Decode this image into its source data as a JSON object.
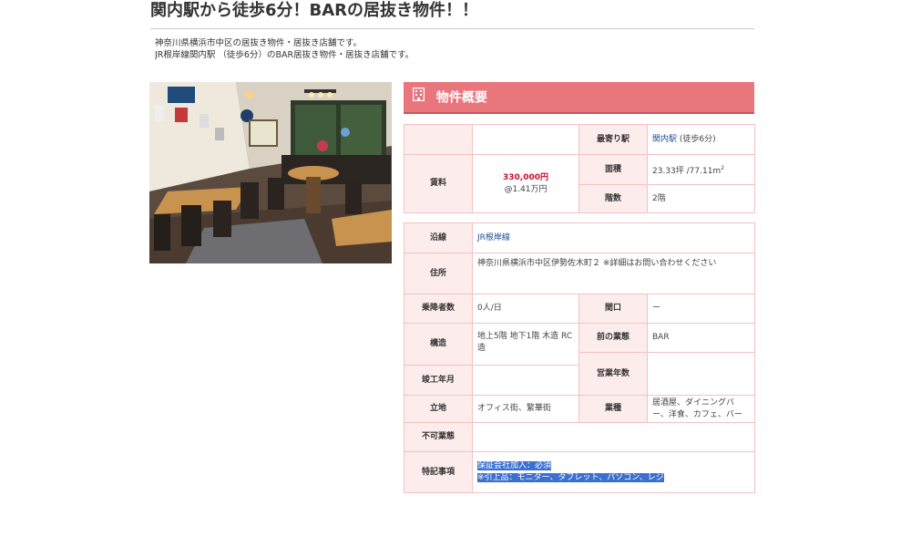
{
  "page": {
    "title": "関内駅から徒歩6分！BARの居抜き物件！！",
    "description_lines": [
      "神奈川県横浜市中区の居抜き物件・居抜き店舗です。",
      "JR根岸線関内駅 （徒歩6分）のBAR居抜き物件・居抜き店舗です。"
    ]
  },
  "overview": {
    "header": "物件概要",
    "rent_label": "賃料",
    "rent_value": "330,000円",
    "rent_per_tsubo": "@1.41万円",
    "station_label": "最寄り駅",
    "station_name": "関内駅",
    "station_walk": " (徒歩6分)",
    "area_label": "面積",
    "area_value": "23.33坪 /77.11m",
    "area_sup": "2",
    "floor_label": "階数",
    "floor_value": "2階"
  },
  "details": {
    "line_label": "沿線",
    "line_value": "JR根岸線",
    "address_label": "住所",
    "address_value": "神奈川県横浜市中区伊勢佐木町２ ※詳細はお問い合わせください",
    "passengers_label": "乗降者数",
    "passengers_value": "0人/日",
    "frontage_label": "間口",
    "frontage_value": "ー",
    "structure_label": "構造",
    "structure_value": "地上5階 地下1階 木造 RC造",
    "prev_business_label": "前の業態",
    "prev_business_value": "BAR",
    "built_label": "竣工年月",
    "built_value": "",
    "years_label": "営業年数",
    "years_value": "",
    "location_label": "立地",
    "location_value": "オフィス街、繁華街",
    "category_label": "業種",
    "category_value": "居酒屋、ダイニングバー、洋食、カフェ、バー",
    "prohibited_label": "不可業態",
    "prohibited_value": "",
    "notes_label": "特記事項",
    "notes_line1": "保証会社加入：必須",
    "notes_line2": "※引上品：モニター、タブレット、パソコン、レジ"
  },
  "colors": {
    "header_bg": "#e9767c",
    "label_bg": "#fdecec",
    "border": "#f2c2c4",
    "price": "#c8102e",
    "link": "#1f4f8f",
    "selection": "#3b6fd1"
  },
  "icons": {
    "section_icon": "building-icon"
  }
}
